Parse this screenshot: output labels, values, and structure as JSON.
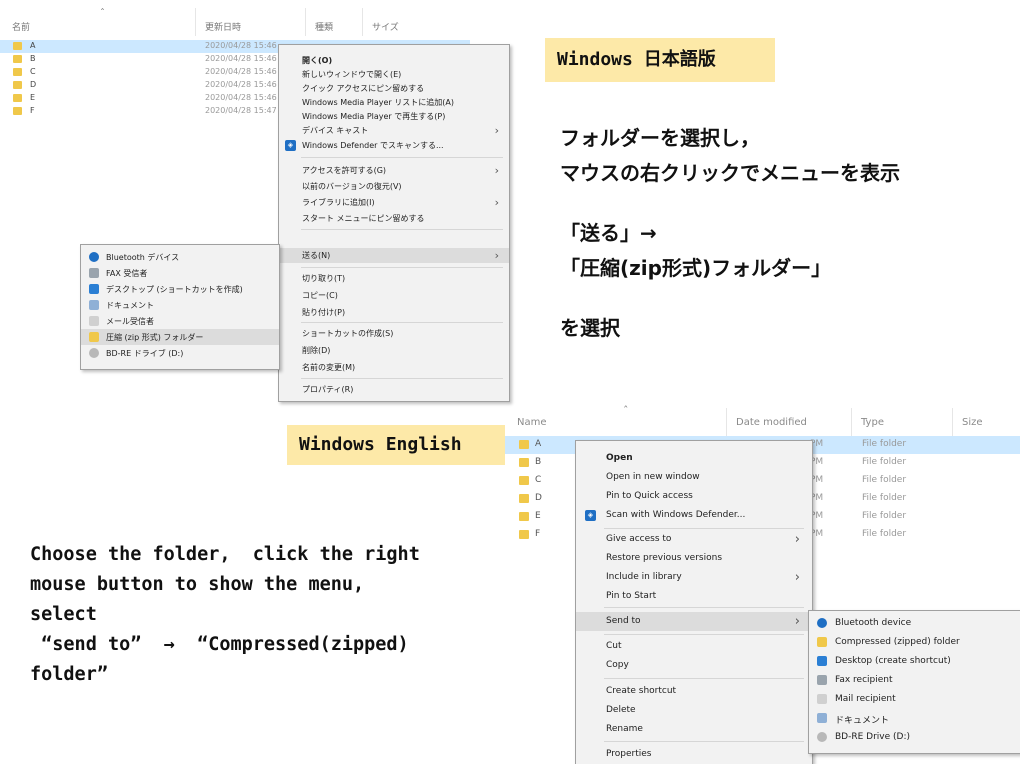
{
  "jp_explorer": {
    "headers": {
      "name": "名前",
      "date": "更新日時",
      "type": "種類",
      "size": "サイズ"
    },
    "rows": [
      {
        "name": "A",
        "date": "2020/04/28 15:46"
      },
      {
        "name": "B",
        "date": "2020/04/28 15:46"
      },
      {
        "name": "C",
        "date": "2020/04/28 15:46"
      },
      {
        "name": "D",
        "date": "2020/04/28 15:46"
      },
      {
        "name": "E",
        "date": "2020/04/28 15:46"
      },
      {
        "name": "F",
        "date": "2020/04/28 15:47"
      }
    ],
    "menu": [
      "開く(O)",
      "新しいウィンドウで開く(E)",
      "クイック アクセスにピン留めする",
      "Windows Media Player リストに追加(A)",
      "Windows Media Player で再生する(P)",
      "デバイス キャスト",
      "Windows Defender でスキャンする...",
      "アクセスを許可する(G)",
      "以前のバージョンの復元(V)",
      "ライブラリに追加(I)",
      "スタート メニューにピン留めする",
      "送る(N)",
      "切り取り(T)",
      "コピー(C)",
      "貼り付け(P)",
      "ショートカットの作成(S)",
      "削除(D)",
      "名前の変更(M)",
      "プロパティ(R)"
    ],
    "submenu": [
      "Bluetooth デバイス",
      "FAX 受信者",
      "デスクトップ (ショートカットを作成)",
      "ドキュメント",
      "メール受信者",
      "圧縮 (zip 形式) フォルダー",
      "BD-RE ドライブ (D:)"
    ]
  },
  "jp_label": "Windows 日本語版",
  "jp_instructions": {
    "line1": "フォルダーを選択し，",
    "line2": "マウスの右クリックでメニューを表示",
    "line3": "「送る」→",
    "line4": "「圧縮(zip形式)フォルダー」",
    "line5": "を選択"
  },
  "en_label": "Windows English",
  "en_instructions": {
    "line1": "Choose the folder,  click the right",
    "line2": "mouse button to show the menu,",
    "line3": "select",
    "line4": " “send to”  →  “Compressed(zipped)",
    "line5": "folder”"
  },
  "en_explorer": {
    "headers": {
      "name": "Name",
      "date": "Date modified",
      "type": "Type",
      "size": "Size"
    },
    "rows": [
      {
        "name": "A",
        "pm": "PM",
        "type": "File folder"
      },
      {
        "name": "B",
        "pm": "PM",
        "type": "File folder"
      },
      {
        "name": "C",
        "pm": "PM",
        "type": "File folder"
      },
      {
        "name": "D",
        "pm": "PM",
        "type": "File folder"
      },
      {
        "name": "E",
        "pm": "PM",
        "type": "File folder"
      },
      {
        "name": "F",
        "pm": "PM",
        "type": "File folder"
      }
    ],
    "menu": [
      "Open",
      "Open in new window",
      "Pin to Quick access",
      "Scan with Windows Defender...",
      "Give access to",
      "Restore previous versions",
      "Include in library",
      "Pin to Start",
      "Send to",
      "Cut",
      "Copy",
      "Create shortcut",
      "Delete",
      "Rename",
      "Properties"
    ],
    "submenu": [
      "Bluetooth device",
      "Compressed (zipped) folder",
      "Desktop (create shortcut)",
      "Fax recipient",
      "Mail recipient",
      "ドキュメント",
      "BD-RE Drive (D:)"
    ]
  },
  "colors": {
    "label_bg": "#fde9a8",
    "selection": "#cce8ff",
    "folder": "#f0c84a",
    "shield": "#1f6fc4"
  }
}
